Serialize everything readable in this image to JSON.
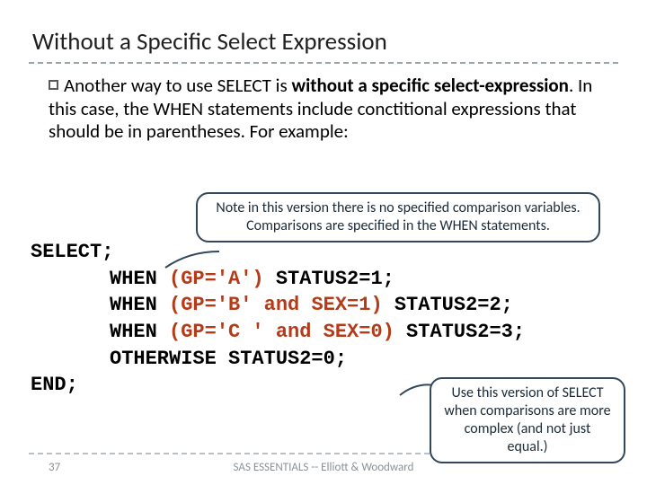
{
  "title": "Without a Specific Select Expression",
  "paragraph": {
    "lead": "Another way to use SELECT is ",
    "bold": "without a specific select-expression",
    "rest": ". In this case, the WHEN statements include conctitional expressions that should be in parentheses. For example:"
  },
  "callout_top": "Note in this version there is no specified comparison variables. Comparisons are specified in the WHEN statements.",
  "callout_bottom": "Use this version of SELECT when comparisons are more complex (and not just equal.)",
  "code": {
    "select": "SELECT;",
    "when1_a": "WHEN ",
    "when1_paren": "(GP='A')",
    "when1_b": " STATUS2=1;",
    "when2_a": "WHEN ",
    "when2_paren": "(GP='B' and SEX=1)",
    "when2_b": " STATUS2=2;",
    "when3_a": "WHEN ",
    "when3_paren": "(GP='C ' and SEX=0)",
    "when3_b": " STATUS2=3;",
    "otherwise": "OTHERWISE STATUS2=0;",
    "end": "END;"
  },
  "footer": {
    "page": "37",
    "text": "SAS ESSENTIALS -- Elliott & Woodward"
  }
}
